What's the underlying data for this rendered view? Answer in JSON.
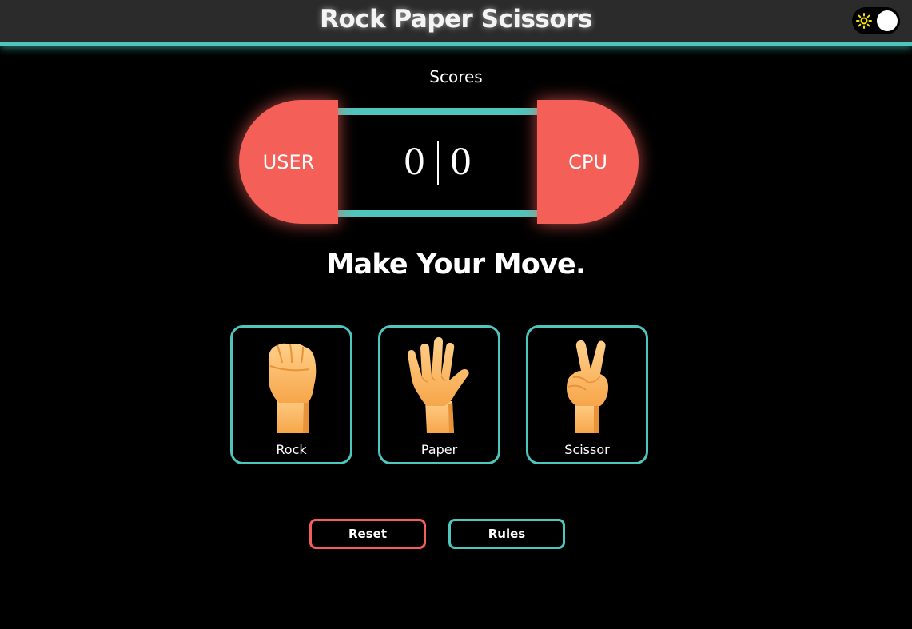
{
  "header": {
    "title": "Rock Paper Scissors",
    "theme_toggle_icon": "sun-icon"
  },
  "scores": {
    "label": "Scores",
    "user_label": "USER",
    "cpu_label": "CPU",
    "user_score": "0",
    "cpu_score": "0"
  },
  "prompt": "Make Your Move.",
  "choices": [
    {
      "label": "Rock",
      "icon": "fist-icon"
    },
    {
      "label": "Paper",
      "icon": "open-hand-icon"
    },
    {
      "label": "Scissor",
      "icon": "victory-hand-icon"
    }
  ],
  "actions": {
    "reset_label": "Reset",
    "rules_label": "Rules"
  },
  "colors": {
    "accent": "#4ec6bd",
    "score_pill": "#f45f58",
    "header_bg": "#2b2b2b",
    "background": "#000000",
    "sun": "#f5e400"
  }
}
